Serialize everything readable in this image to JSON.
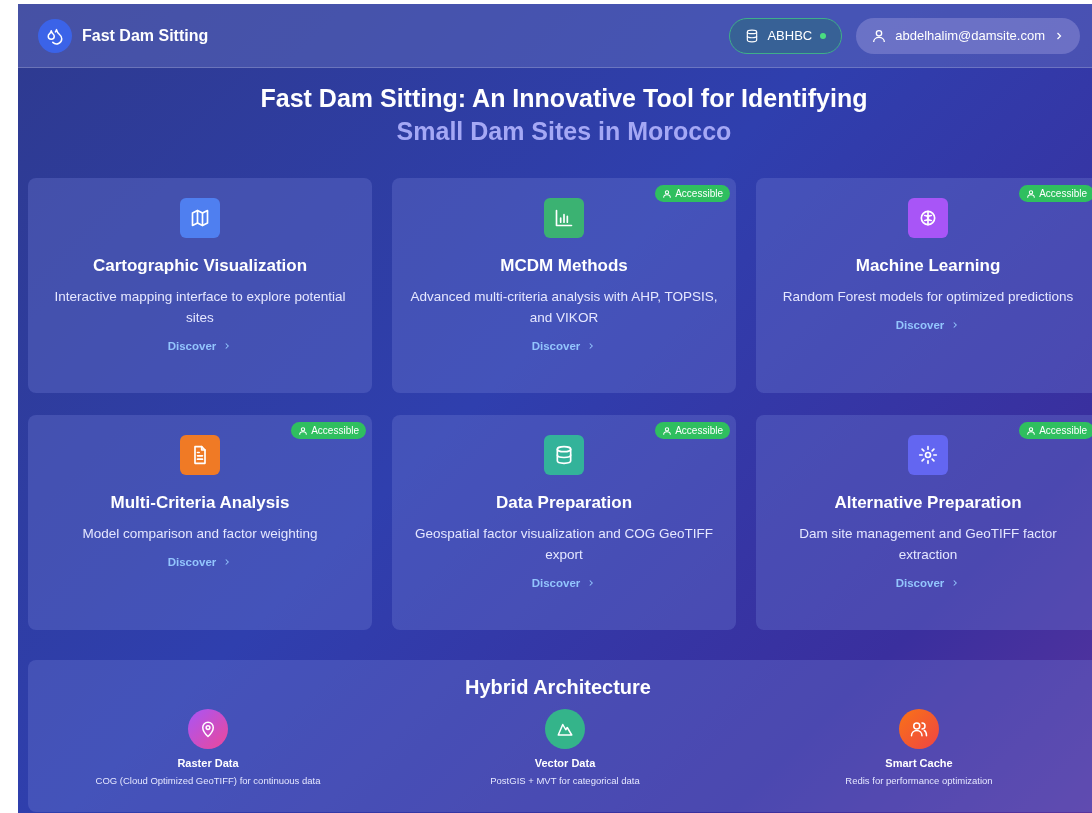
{
  "header": {
    "app_name": "Fast Dam Sitting",
    "org": {
      "label": "ABHBC",
      "online": true
    },
    "user": "abdelhalim@damsite.com"
  },
  "hero": {
    "title": "Fast Dam Sitting: An Innovative Tool for Identifying",
    "subtitle": "Small Dam Sites in Morocco"
  },
  "modules": [
    {
      "kind": "map",
      "color": "#4f7ff0",
      "title": "Cartographic Visualization",
      "description": "Interactive mapping interface to explore potential sites",
      "link": "Discover",
      "accessible": false
    },
    {
      "kind": "chart",
      "color": "#3bb272",
      "title": "MCDM Methods",
      "description": "Advanced multi-criteria analysis with AHP, TOPSIS, and VIKOR",
      "link": "Discover",
      "accessible": true,
      "badge": "Accessible"
    },
    {
      "kind": "brain",
      "color": "#a855f7",
      "title": "Machine Learning",
      "description": "Random Forest models for optimized predictions",
      "link": "Discover",
      "accessible": true,
      "badge": "Accessible"
    },
    {
      "kind": "document",
      "color": "#f07a25",
      "title": "Multi-Criteria Analysis",
      "description": "Model comparison and factor weighting",
      "link": "Discover",
      "accessible": true,
      "badge": "Accessible"
    },
    {
      "kind": "database",
      "color": "#33b39a",
      "title": "Data Preparation",
      "description": "Geospatial factor visualization and COG GeoTIFF export",
      "link": "Discover",
      "accessible": true,
      "badge": "Accessible"
    },
    {
      "kind": "gear",
      "color": "#6366f1",
      "title": "Alternative Preparation",
      "description": "Dam site management and GeoTIFF factor extraction",
      "link": "Discover",
      "accessible": true,
      "badge": "Accessible"
    }
  ],
  "architecture": {
    "title": "Hybrid Architecture",
    "items": [
      {
        "kind": "pin",
        "title": "Raster Data",
        "description": "COG (Cloud Optimized GeoTIFF) for continuous data"
      },
      {
        "kind": "mountain",
        "title": "Vector Data",
        "description": "PostGIS + MVT for categorical data"
      },
      {
        "kind": "users",
        "title": "Smart Cache",
        "description": "Redis for performance optimization"
      }
    ]
  }
}
